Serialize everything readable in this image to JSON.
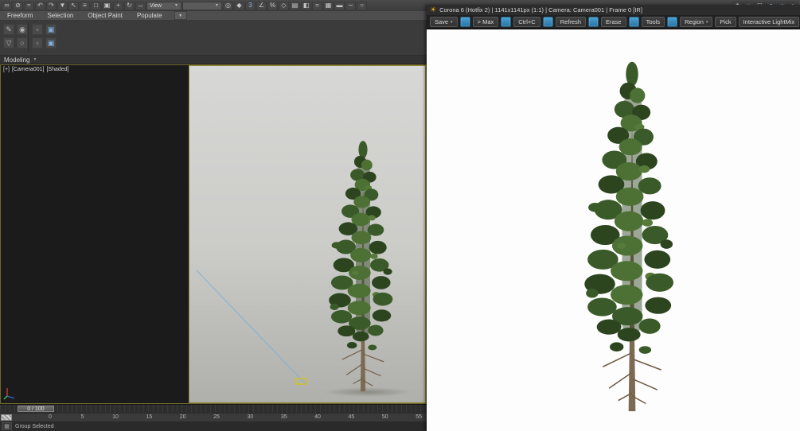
{
  "glyphs": {
    "caret_down": "▼",
    "caret_small": "▾",
    "grid": "▦",
    "sun": "☀",
    "plus_box": "+"
  },
  "max": {
    "toolbar": {
      "icons_left": [
        {
          "name": "select-link-icon",
          "glyph": "∞"
        },
        {
          "name": "unlink-selection-icon",
          "glyph": "⊘"
        },
        {
          "name": "bind-to-spacewarp-icon",
          "glyph": "≈"
        },
        {
          "name": "undo-icon",
          "glyph": "↶"
        },
        {
          "name": "redo-icon",
          "glyph": "↷"
        },
        {
          "name": "selection-filter-icon",
          "glyph": "▼"
        },
        {
          "name": "select-object-icon",
          "glyph": "↖"
        },
        {
          "name": "select-by-name-icon",
          "glyph": "≡"
        },
        {
          "name": "selection-region-icon",
          "glyph": "□"
        },
        {
          "name": "window-crossing-icon",
          "glyph": "▣"
        },
        {
          "name": "select-and-move-icon",
          "glyph": "+"
        },
        {
          "name": "select-and-rotate-icon",
          "glyph": "↻"
        },
        {
          "name": "select-and-scale-icon",
          "glyph": "↔"
        }
      ],
      "view_dropdown_value": "View",
      "selection_set_value": "",
      "icons_right": [
        {
          "name": "use-pivot-center-icon",
          "glyph": "◎"
        },
        {
          "name": "select-and-manipulate-icon",
          "glyph": "◆"
        },
        {
          "name": "snaps-toggle-icon",
          "glyph": "3",
          "color": "#8fb7d9"
        },
        {
          "name": "angle-snap-icon",
          "glyph": "∠"
        },
        {
          "name": "percent-snap-icon",
          "glyph": "%"
        },
        {
          "name": "spinner-snap-icon",
          "glyph": "◇"
        },
        {
          "name": "edit-named-selection-icon",
          "glyph": "▤"
        },
        {
          "name": "mirror-icon",
          "glyph": "◧"
        },
        {
          "name": "align-icon",
          "glyph": "="
        },
        {
          "name": "layer-manager-icon",
          "glyph": "▦"
        },
        {
          "name": "ribbon-toggle-icon",
          "glyph": "▬"
        },
        {
          "name": "curve-editor-icon",
          "glyph": "∼"
        },
        {
          "name": "schematic-view-icon",
          "glyph": "○"
        }
      ],
      "icons_far": [
        {
          "name": "material-editor-icon",
          "glyph": "◆",
          "color": "#bfbfbf"
        },
        {
          "name": "render-setup-icon",
          "glyph": "☼",
          "color": "#bfbfbf"
        },
        {
          "name": "rendered-frame-window-icon",
          "glyph": "◻",
          "color": "#bfbfbf"
        },
        {
          "name": "render-production-icon",
          "glyph": "●",
          "color": "#8fb7d9"
        },
        {
          "name": "render-in-cloud-icon",
          "glyph": "○",
          "color": "#8fb7d9"
        },
        {
          "name": "render-iterative-icon",
          "glyph": "◐",
          "color": "#8fb7d9"
        }
      ]
    },
    "ribbon": {
      "tabs": [
        {
          "name": "tab-freeform",
          "label": "Freeform"
        },
        {
          "name": "tab-selection",
          "label": "Selection"
        },
        {
          "name": "tab-object-paint",
          "label": "Object Paint"
        },
        {
          "name": "tab-populate",
          "label": "Populate"
        }
      ],
      "tools_a": [
        {
          "name": "polydraw-icon",
          "glyph": "✎"
        },
        {
          "name": "paint-deform-icon",
          "glyph": "◉"
        },
        {
          "name": "optimize-icon",
          "glyph": "▽"
        },
        {
          "name": "shapes-icon",
          "glyph": "○"
        }
      ],
      "tools_b": [
        {
          "name": "defaults-icon",
          "glyph": "▫"
        },
        {
          "name": "edit-poly-mode-icon",
          "glyph": "▣",
          "color": "#7fb2e2"
        },
        {
          "name": "presets-icon",
          "glyph": "▫"
        },
        {
          "name": "step-mode-icon",
          "glyph": "▣",
          "color": "#7fb2e2"
        }
      ]
    },
    "modeling": {
      "label": "Modeling"
    },
    "viewport": {
      "label_plus": "[+]",
      "label_camera": "[Camera001]",
      "label_shading": "[Shaded]"
    },
    "timeline": {
      "slider_value": "0 / 100",
      "ruler_labels": [
        "0",
        "5",
        "10",
        "15",
        "20",
        "25",
        "30",
        "35",
        "40",
        "45",
        "50",
        "55"
      ]
    },
    "status": {
      "selection_text": "Group Selected"
    }
  },
  "corona": {
    "title": "Corona 6 (Hotfix 2) | 1141x1141px (1:1) | Camera: Camera001 | Frame 0 [IR]",
    "toolbar": {
      "save": "Save",
      "to_max": "> Max",
      "copy": "Ctrl+C",
      "refresh": "Refresh",
      "erase": "Erase",
      "tools": "Tools",
      "region": "Region",
      "pick": "Pick",
      "lightmix": "Interactive LightMix"
    }
  },
  "colors": {
    "corona_accent_blue": "#3e96c8",
    "corona_sun_orange": "#f2a81d",
    "safe_frame_yellow": "#8f8436",
    "viewport_bg_gray": "#c9c9c6",
    "foliage_dark": "#2c451f",
    "foliage_mid": "#3a5a29",
    "foliage_light": "#4d7034",
    "trunk_brown": "#7d6a52",
    "spline_blue": "#7fb2d9"
  }
}
